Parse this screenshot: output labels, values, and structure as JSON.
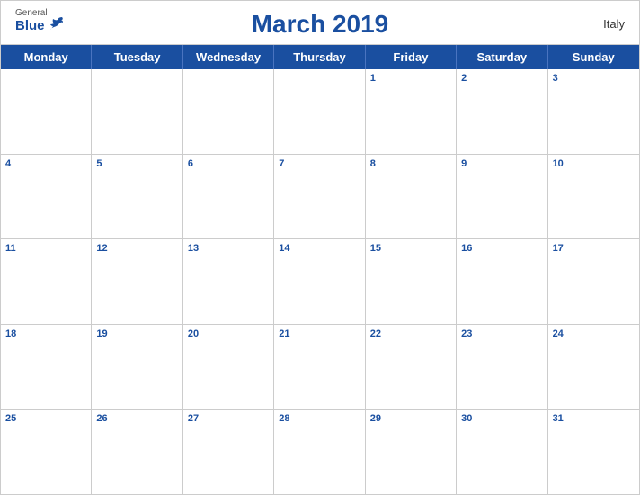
{
  "header": {
    "title": "March 2019",
    "country": "Italy",
    "logo": {
      "general": "General",
      "blue": "Blue"
    }
  },
  "days_of_week": [
    "Monday",
    "Tuesday",
    "Wednesday",
    "Thursday",
    "Friday",
    "Saturday",
    "Sunday"
  ],
  "weeks": [
    [
      null,
      null,
      null,
      null,
      1,
      2,
      3
    ],
    [
      4,
      5,
      6,
      7,
      8,
      9,
      10
    ],
    [
      11,
      12,
      13,
      14,
      15,
      16,
      17
    ],
    [
      18,
      19,
      20,
      21,
      22,
      23,
      24
    ],
    [
      25,
      26,
      27,
      28,
      29,
      30,
      31
    ]
  ],
  "colors": {
    "header_bg": "#1a4fa0",
    "header_text": "#ffffff",
    "day_number": "#1a4fa0",
    "border": "#cccccc"
  }
}
